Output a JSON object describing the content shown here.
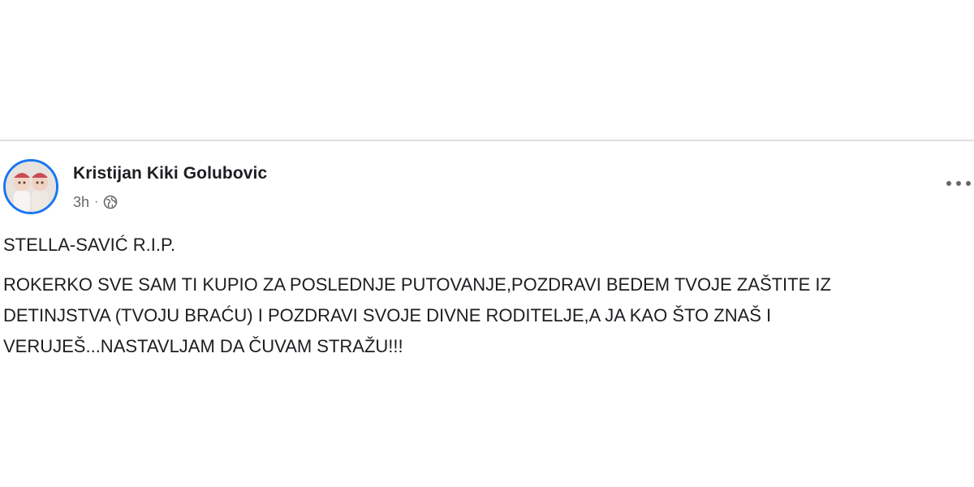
{
  "post": {
    "author": "Kristijan Kiki Golubovic",
    "time": "3h",
    "separator": "·",
    "privacy_icon": "globe-icon",
    "more_icon": "more-options-icon",
    "line1": "STELLA-SAVIĆ R.I.P.",
    "body": "ROKERKO SVE SAM TI KUPIO ZA POSLEDNJE PUTOVANJE,POZDRAVI BEDEM TVOJE ZAŠTITE IZ DETINJSTVA (TVOJU BRAĆU) I POZDRAVI SVOJE DIVNE RODITELJE,A JA KAO ŠTO ZNAŠ I VERUJEŠ...NASTAVLJAM DA ČUVAM STRAŽU!!!"
  },
  "colors": {
    "accent": "#1877f2",
    "text": "#1c1e21",
    "secondary_text": "#65676b"
  }
}
